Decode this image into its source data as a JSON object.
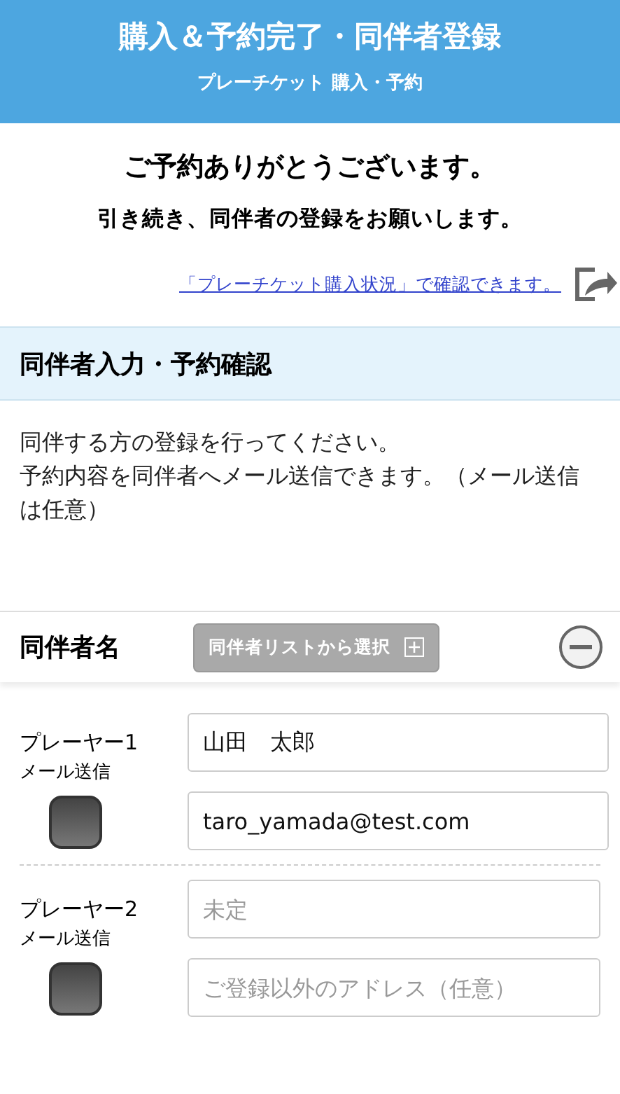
{
  "header": {
    "title": "購入＆予約完了・同伴者登録",
    "subtitle": "プレーチケット 購入・予約"
  },
  "thanks": {
    "title": "ご予約ありがとうございます。",
    "message": "引き続き、同伴者の登録をお願いします。",
    "link": "「プレーチケット購入状況」で確認できます。"
  },
  "section": {
    "title": "同伴者入力・予約確認",
    "lines": [
      "同伴する方の登録を行ってください。",
      "予約内容を同伴者へメール送信できます。（メール送信は任意）"
    ]
  },
  "companions": {
    "label": "同伴者名",
    "list_button": "同伴者リストから選択"
  },
  "players": [
    {
      "label": "プレーヤー1",
      "mail_label": "メール送信",
      "checked": false,
      "name": {
        "value": "山田　太郎"
      },
      "email": {
        "value": "taro_yamada@test.com"
      }
    },
    {
      "label": "プレーヤー2",
      "mail_label": "メール送信",
      "checked": false,
      "name": {
        "placeholder": "未定"
      },
      "email": {
        "placeholder": "ご登録以外のアドレス（任意）"
      }
    }
  ]
}
